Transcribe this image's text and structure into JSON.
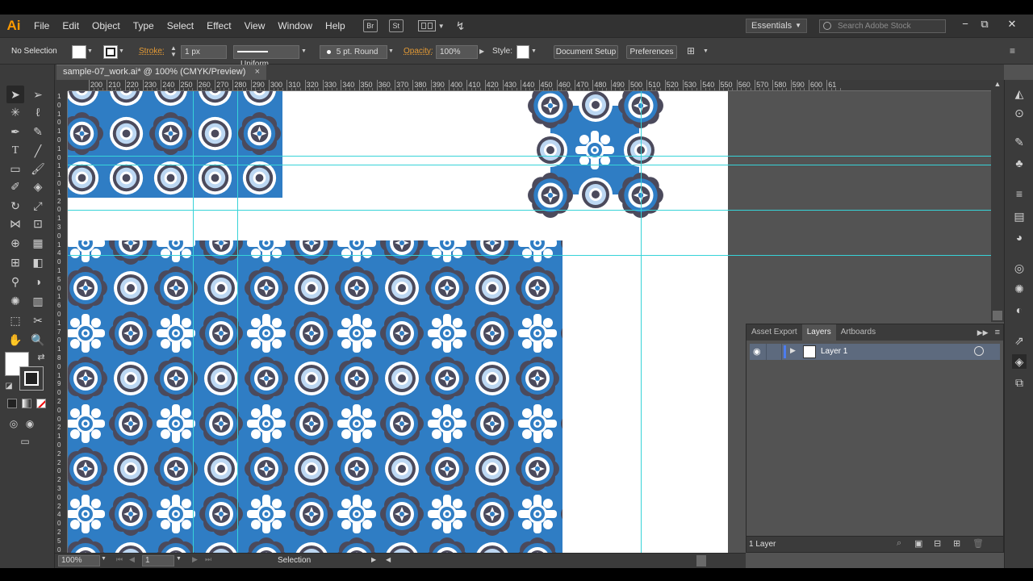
{
  "app": {
    "logo": "Ai"
  },
  "menu": [
    "File",
    "Edit",
    "Object",
    "Type",
    "Select",
    "Effect",
    "View",
    "Window",
    "Help"
  ],
  "appicons": {
    "bridge": "Br",
    "stock": "St"
  },
  "workspace": {
    "label": "Essentials"
  },
  "search": {
    "placeholder": "Search Adobe Stock"
  },
  "control": {
    "selection": "No Selection",
    "stroke_label": "Stroke:",
    "stroke_weight": "1 px",
    "profile": "Uniform",
    "brush": "5 pt. Round",
    "opacity_label": "Opacity:",
    "opacity": "100%",
    "style_label": "Style:",
    "doc_setup": "Document Setup",
    "preferences": "Preferences"
  },
  "document": {
    "tab": "sample-07_work.ai* @ 100% (CMYK/Preview)",
    "close": "×"
  },
  "ruler": {
    "h_ticks": [
      "200",
      "210",
      "220",
      "230",
      "240",
      "250",
      "260",
      "270",
      "280",
      "290",
      "300",
      "310",
      "320",
      "330",
      "340",
      "350",
      "360",
      "370",
      "380",
      "390",
      "400",
      "410",
      "420",
      "430",
      "440",
      "450",
      "460",
      "470",
      "480",
      "490",
      "500",
      "510",
      "520",
      "530",
      "540",
      "550",
      "560",
      "570",
      "580",
      "590",
      "600",
      "61"
    ],
    "v_digits": [
      "1",
      "0",
      "1",
      "0",
      "1",
      "0",
      "1",
      "0",
      "1",
      "1",
      "0",
      "1",
      "2",
      "0",
      "1",
      "3",
      "0",
      "1",
      "4",
      "0",
      "1",
      "5",
      "0",
      "1",
      "6",
      "0",
      "1",
      "7",
      "0",
      "1",
      "8",
      "0",
      "1",
      "9",
      "0",
      "2",
      "0",
      "0",
      "2",
      "1",
      "0",
      "2",
      "2",
      "0",
      "2",
      "3",
      "0",
      "2",
      "4",
      "0",
      "2",
      "5",
      "0"
    ]
  },
  "status": {
    "zoom": "100%",
    "page": "1",
    "mode": "Selection"
  },
  "layers": {
    "tabs": [
      "Asset Export",
      "Layers",
      "Artboards"
    ],
    "active_tab": "Layers",
    "rows": [
      {
        "name": "Layer 1"
      }
    ],
    "count": "1 Layer"
  },
  "colors": {
    "accent_orange": "#ff9a00",
    "guide": "#37d3d8",
    "pattern_blue": "#2f7dc4",
    "pattern_dark": "#4b4a5c",
    "pattern_light": "#bcd7f2"
  },
  "icons": {
    "eye": "eye-icon",
    "search": "search-icon",
    "expand": "triangle-right-icon"
  }
}
